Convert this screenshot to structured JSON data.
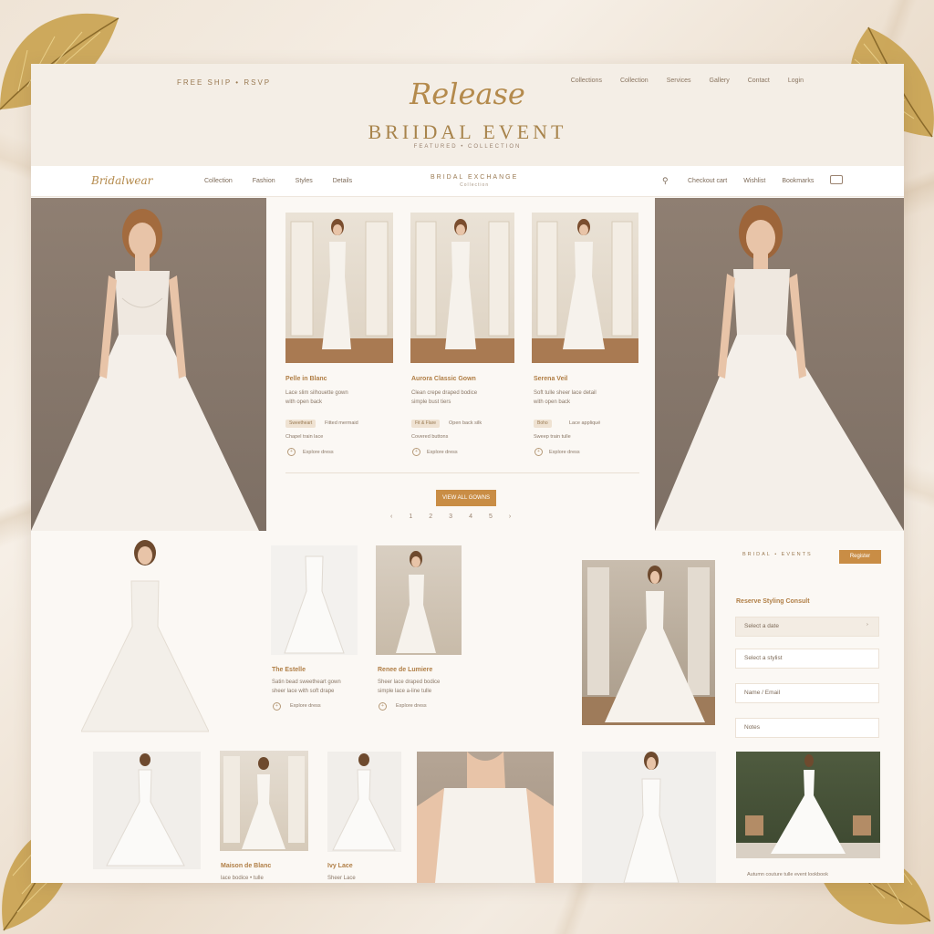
{
  "colors": {
    "gold": "#b48a4c",
    "accent_button": "#c98d45",
    "page_bg": "#fbf8f4",
    "header_band": "#f4eee6",
    "studio_wall": "#8d7d70"
  },
  "top_bar": {
    "left_text": "FREE SHIP • RSVP",
    "links": [
      "Collections",
      "Collection",
      "Services",
      "Gallery",
      "Contact",
      "Login"
    ]
  },
  "header": {
    "script": "Release",
    "title": "BRIIDAL EVENT",
    "subtitle": "FEATURED • COLLECTION"
  },
  "nav": {
    "logo": "Bridalwear",
    "links": [
      "Collection",
      "Fashion",
      "Styles",
      "Details"
    ],
    "center_title": "BRIDAL EXCHANGE",
    "center_sub": "Collection",
    "search_icon": "search-icon",
    "right_links": [
      "Checkout cart",
      "Wishlist",
      "Bookmarks"
    ],
    "message_icon": "mail-icon"
  },
  "feature_cards": [
    {
      "title": "Pelle in Blanc",
      "text1": "Lace slim silhouette gown",
      "text2": "with open back",
      "tag": "Sweetheart",
      "tag_text1": "Fitted mermaid",
      "tag_text2": "Chapel train lace",
      "link": "Explore dress"
    },
    {
      "title": "Aurora Classic Gown",
      "text1": "Clean crepe draped bodice",
      "text2": "simple bust tiers",
      "tag": "Fit & Flare",
      "tag_text1": "Open back silk",
      "tag_text2": "Covered buttons",
      "link": "Explore dress"
    },
    {
      "title": "Serena Veil",
      "text1": "Soft tulle sheer lace detail",
      "text2": "with open back",
      "tag": "Boho",
      "tag_text1": "Lace appliqué",
      "tag_text2": "Sweep train tulle",
      "link": "Explore dress"
    }
  ],
  "center_button": "VIEW ALL GOWNS",
  "pagination": [
    "‹",
    "1",
    "2",
    "3",
    "4",
    "5",
    "›"
  ],
  "mid_cards": [
    {
      "title": "The Estelle",
      "text1": "Satin bead sweetheart gown",
      "text2": "sheer lace with soft drape",
      "link": "Explore dress"
    },
    {
      "title": "Renee de Lumiere",
      "text1": "Sheer lace draped bodice",
      "text2": "simple lace a-line tulle",
      "link": "Explore dress"
    }
  ],
  "sidebar": {
    "heading": "BRIDAL • EVENTS",
    "button": "Register",
    "subheading": "Reserve Styling Consult",
    "fields": [
      "Select a date",
      "Select a stylist",
      "Name / Email",
      "Notes"
    ]
  },
  "bottom_cards": [
    {
      "title": "Maison de Blanc",
      "text": "lace bodice • tulle"
    },
    {
      "title": "Ivy Lace",
      "text": "Sheer Lace"
    }
  ],
  "footer_caption": "Autumn couture tulle event lookbook"
}
